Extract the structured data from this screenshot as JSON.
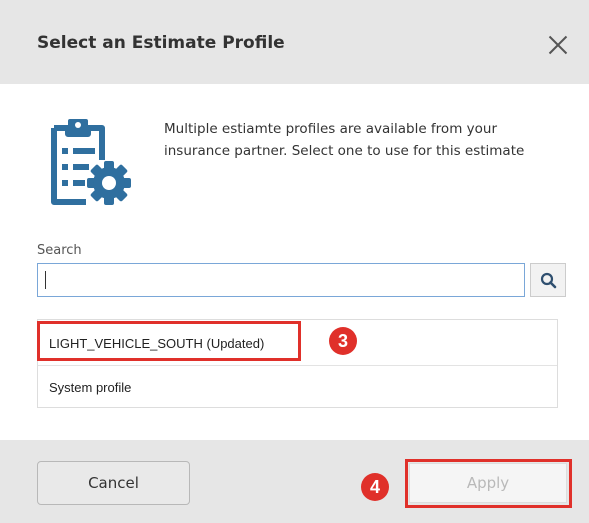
{
  "dialog": {
    "title": "Select an Estimate Profile",
    "description": "Multiple estiamte profiles are available from your insurance partner. Select one to use for this estimate"
  },
  "search": {
    "label": "Search",
    "value": "",
    "placeholder": ""
  },
  "profiles": [
    {
      "label": "LIGHT_VEHICLE_SOUTH (Updated)"
    },
    {
      "label": "System profile"
    }
  ],
  "annotations": {
    "step3": "3",
    "step4": "4",
    "highlight_color": "#e0302a"
  },
  "footer": {
    "cancel_label": "Cancel",
    "apply_label": "Apply",
    "apply_disabled": true
  },
  "icons": {
    "close": "close-icon",
    "search": "search-icon",
    "profile": "clipboard-gear-icon"
  },
  "colors": {
    "accent": "#2f6f9f",
    "header_bg": "#e6e6e6",
    "annotation": "#e0302a"
  }
}
